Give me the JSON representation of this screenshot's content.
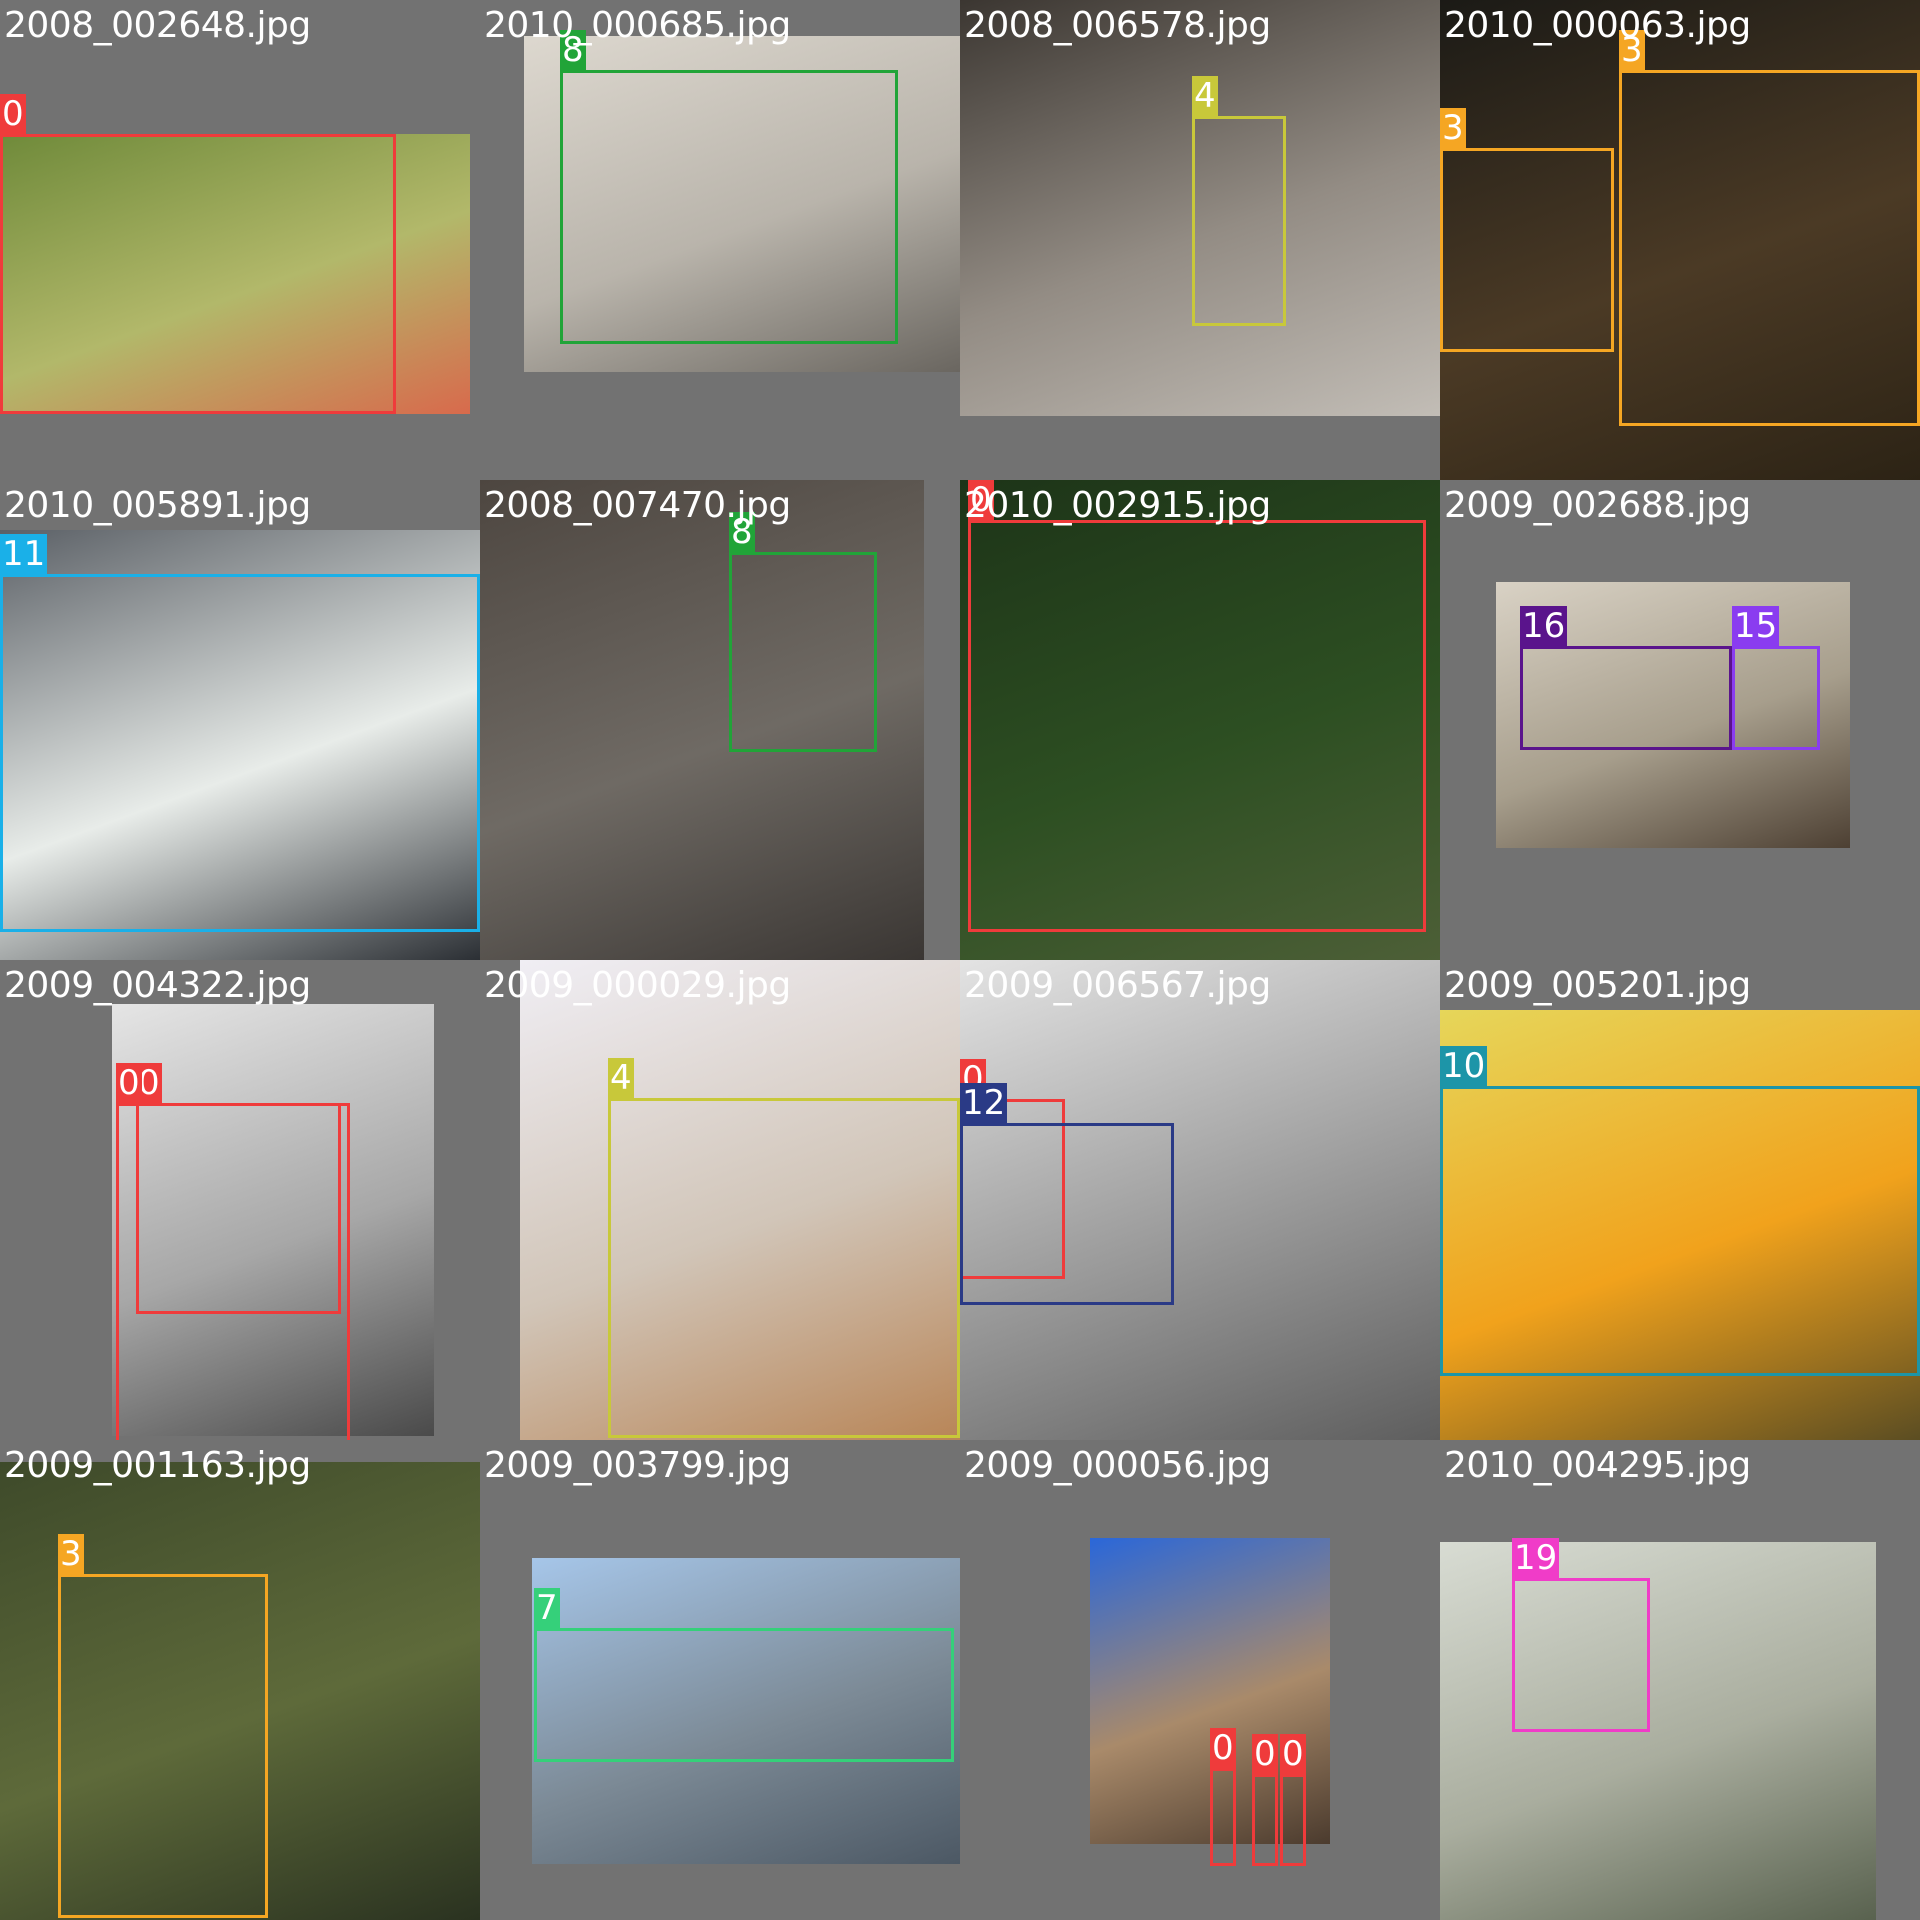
{
  "grid": {
    "columns": 4,
    "rows": 4
  },
  "tiles": [
    {
      "filename": "2008_002648.jpg",
      "photo_colors": [
        "#6f8a3a",
        "#b2b86a",
        "#d86a4c"
      ],
      "boxes": [
        {
          "class_id": "0",
          "color": "#ef3b3b"
        }
      ]
    },
    {
      "filename": "2010_000685.jpg",
      "photo_colors": [
        "#ddd8cf",
        "#b9b4ab",
        "#6a6660"
      ],
      "boxes": [
        {
          "class_id": "8",
          "color": "#21a438"
        }
      ]
    },
    {
      "filename": "2008_006578.jpg",
      "photo_colors": [
        "#3b3631",
        "#938c84",
        "#c2bdb6"
      ],
      "boxes": [
        {
          "class_id": "4",
          "color": "#c8c83a"
        }
      ]
    },
    {
      "filename": "2010_000063.jpg",
      "photo_colors": [
        "#1b1a16",
        "#4b3a25",
        "#2c2315"
      ],
      "boxes": [
        {
          "class_id": "3",
          "color": "#f5a623"
        },
        {
          "class_id": "3",
          "color": "#f5a623"
        }
      ]
    },
    {
      "filename": "2010_005891.jpg",
      "photo_colors": [
        "#5b6066",
        "#e8ece9",
        "#2b2f34"
      ],
      "boxes": [
        {
          "class_id": "11",
          "color": "#1ab0e8"
        }
      ]
    },
    {
      "filename": "2008_007470.jpg",
      "photo_colors": [
        "#4d4640",
        "#6f6a64",
        "#3a3633"
      ],
      "boxes": [
        {
          "class_id": "8",
          "color": "#21a438"
        }
      ]
    },
    {
      "filename": "2010_002915.jpg",
      "photo_colors": [
        "#1d3418",
        "#2d4f22",
        "#4d5f37"
      ],
      "boxes": [
        {
          "class_id": "0",
          "color": "#ef3b3b"
        }
      ]
    },
    {
      "filename": "2009_002688.jpg",
      "photo_colors": [
        "#d9d2c5",
        "#a79e8c",
        "#4d4033"
      ],
      "boxes": [
        {
          "class_id": "16",
          "color": "#5a148c"
        },
        {
          "class_id": "15",
          "color": "#8a3cf0"
        }
      ]
    },
    {
      "filename": "2009_004322.jpg",
      "photo_colors": [
        "#e5e5e5",
        "#a7a7a7",
        "#4a4a4a"
      ],
      "boxes": [
        {
          "class_id": "0",
          "color": "#ef3b3b"
        },
        {
          "class_id": "0",
          "color": "#ef3b3b"
        }
      ]
    },
    {
      "filename": "2009_000029.jpg",
      "photo_colors": [
        "#f0eef4",
        "#d1c5b8",
        "#b88557"
      ],
      "boxes": [
        {
          "class_id": "4",
          "color": "#c8c83a"
        }
      ]
    },
    {
      "filename": "2009_006567.jpg",
      "photo_colors": [
        "#e3e3e3",
        "#9a9a9a",
        "#5e5e5e"
      ],
      "boxes": [
        {
          "class_id": "0",
          "color": "#ef3b3b"
        },
        {
          "class_id": "12",
          "color": "#2a3a86"
        }
      ]
    },
    {
      "filename": "2009_005201.jpg",
      "photo_colors": [
        "#e6d65a",
        "#f1a21c",
        "#5b4d22"
      ],
      "boxes": [
        {
          "class_id": "10",
          "color": "#1d95a8"
        }
      ]
    },
    {
      "filename": "2009_001163.jpg",
      "photo_colors": [
        "#3e4a2a",
        "#5e6a3a",
        "#2a3220"
      ],
      "boxes": [
        {
          "class_id": "3",
          "color": "#f5a623"
        }
      ]
    },
    {
      "filename": "2009_003799.jpg",
      "photo_colors": [
        "#a6c6e9",
        "#7c8a96",
        "#4c5864"
      ],
      "boxes": [
        {
          "class_id": "7",
          "color": "#35d07a"
        }
      ]
    },
    {
      "filename": "2009_000056.jpg",
      "photo_colors": [
        "#2a67d9",
        "#a98a6a",
        "#4b3b2e"
      ],
      "boxes": [
        {
          "class_id": "0",
          "color": "#ef3b3b"
        },
        {
          "class_id": "0",
          "color": "#ef3b3b"
        },
        {
          "class_id": "0",
          "color": "#ef3b3b"
        }
      ]
    },
    {
      "filename": "2010_004295.jpg",
      "photo_colors": [
        "#d8dcd3",
        "#a9ad9e",
        "#59624f"
      ],
      "boxes": [
        {
          "class_id": "19",
          "color": "#f03cc8"
        }
      ]
    }
  ]
}
